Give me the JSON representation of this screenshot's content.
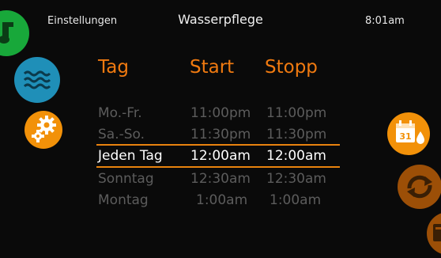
{
  "status": {
    "section": "Einstellungen",
    "page_title": "Wasserpflege",
    "time": "8:01am"
  },
  "left_nav": [
    {
      "icon": "music-note-icon",
      "color": "#18a83a"
    },
    {
      "icon": "water-waves-icon",
      "color": "#1f8fb8"
    },
    {
      "icon": "gears-icon",
      "color": "#f29109"
    }
  ],
  "right_nav": [
    {
      "icon": "calendar-water-icon",
      "color": "#f29109",
      "label": "31"
    },
    {
      "icon": "cycle-arrows-icon",
      "color": "#9c4f07"
    },
    {
      "icon": "calendar-partial-icon",
      "color": "#9c4f07"
    }
  ],
  "table": {
    "columns": [
      "Tag",
      "Start",
      "Stopp"
    ],
    "selected_index": 2,
    "rows": [
      {
        "day": "Mo.-Fr.",
        "start": "11:00pm",
        "stop": "11:00pm"
      },
      {
        "day": "Sa.-So.",
        "start": "11:30pm",
        "stop": "11:30pm"
      },
      {
        "day": "Jeden Tag",
        "start": "12:00am",
        "stop": "12:00am"
      },
      {
        "day": "Sonntag",
        "start": "12:30am",
        "stop": "12:30am"
      },
      {
        "day": "Montag",
        "start": "1:00am",
        "stop": "1:00am"
      }
    ]
  },
  "colors": {
    "accent": "#f07a10",
    "selected_text": "#ffffff",
    "dim_text": "#5c5c5c",
    "background": "#0a0a0a"
  }
}
